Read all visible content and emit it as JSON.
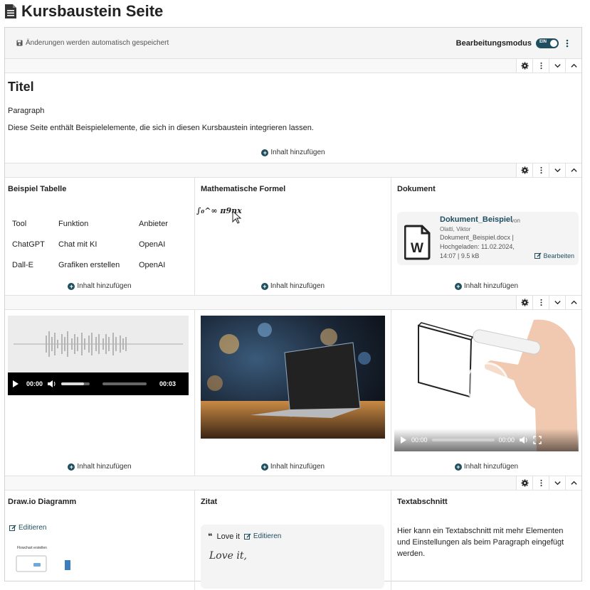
{
  "page": {
    "title": "Kursbaustein Seite"
  },
  "editor": {
    "autosave": "Änderungen werden automatisch gespeichert",
    "mode_label": "Bearbeitungsmodus",
    "toggle_text": "EIN"
  },
  "add_content": "Inhalt hinzufügen",
  "block1": {
    "title": "Titel",
    "paragraph_label": "Paragraph",
    "paragraph_text": "Diese Seite enthält Beispielelemente, die sich in diesen Kursbaustein integrieren lassen."
  },
  "block2": {
    "table_title": "Beispiel Tabelle",
    "table_rows": [
      [
        "Tool",
        "Funktion",
        "Anbieter"
      ],
      [
        "ChatGPT",
        "Chat mit KI",
        "OpenAI"
      ],
      [
        "Dall-E",
        "Grafiken erstellen",
        "OpenAI"
      ]
    ],
    "formula_title": "Mathematische Formel",
    "formula": "∫₀^∞ π9nx",
    "document_title": "Dokument",
    "document": {
      "name": "Dokument_Beispiel",
      "von": "von",
      "author": "Olatti, Viktor",
      "meta": "Dokument_Beispiel.docx | Hochgeladen: 11.02.2024, 14:07 | 9.5 kB",
      "edit": "Bearbeiten"
    }
  },
  "block3": {
    "audio": {
      "time_current": "00:00",
      "time_total": "00:03",
      "volume": 0.8,
      "progress": 0
    },
    "video": {
      "time_current": "00:00",
      "time_total": "00:00"
    }
  },
  "block4": {
    "drawio_title": "Draw.io Diagramm",
    "drawio_edit": "Editieren",
    "drawio_thumb_label": "Flowchart erstellen",
    "quote_title": "Zitat",
    "quote_label": "Love it",
    "quote_edit": "Editieren",
    "quote_text": "Love it,",
    "text_title": "Textabschnitt",
    "text_body": "Hier kann ein Textabschnitt mit mehr Elementen und Einstellungen als beim Paragraph eingefügt werden."
  },
  "colors": {
    "accent": "#1f4e5f",
    "toolbar_bg": "#f5f5f5",
    "border": "#e1e1e1"
  },
  "icons": [
    "document-icon",
    "save-icon",
    "gear-icon",
    "kebab-icon",
    "chevron-down-icon",
    "chevron-up-icon",
    "plus-circle-icon",
    "word-file-icon",
    "edit-icon",
    "play-icon",
    "volume-icon",
    "fullscreen-icon",
    "quote-icon"
  ]
}
